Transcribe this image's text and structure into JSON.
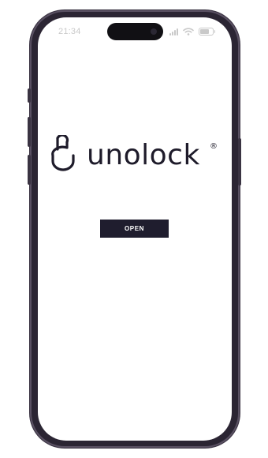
{
  "status_bar": {
    "time": "21:34",
    "icons": [
      "signal-icon",
      "wifi-icon",
      "battery-icon"
    ]
  },
  "brand": {
    "name": "unolock",
    "registered_symbol": "®",
    "logo_icon": "padlock-icon"
  },
  "actions": {
    "open_label": "OPEN"
  },
  "colors": {
    "brand_dark": "#1f1d2e",
    "frame": "#2b2533",
    "status_text": "#c9c9c9",
    "background": "#ffffff"
  }
}
